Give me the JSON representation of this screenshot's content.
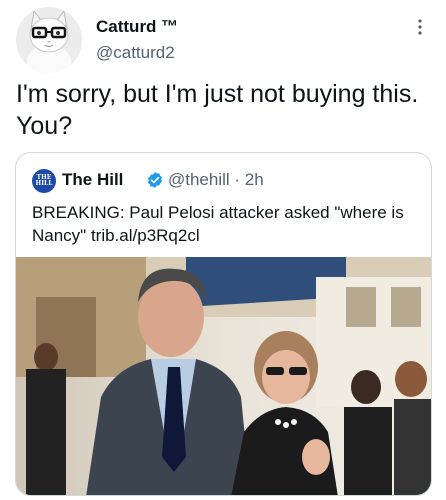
{
  "author": {
    "name": "Catturd ™",
    "handle": "@catturd2"
  },
  "tweet": {
    "text": "I'm sorry, but I'm just not buying this. You?"
  },
  "quoted": {
    "logo_text": "THE HILL",
    "name": "The Hill",
    "handle_time": "@thehill · 2h",
    "text": "BREAKING: Paul Pelosi attacker asked \"where is Nancy\" trib.al/p3Rq2cl"
  },
  "icons": {
    "more": "more-icon",
    "verified": "verified-badge-icon"
  },
  "colors": {
    "text": "#0f1419",
    "secondary": "#536471",
    "border": "#cfd9de",
    "verified": "#1d9bf0"
  }
}
